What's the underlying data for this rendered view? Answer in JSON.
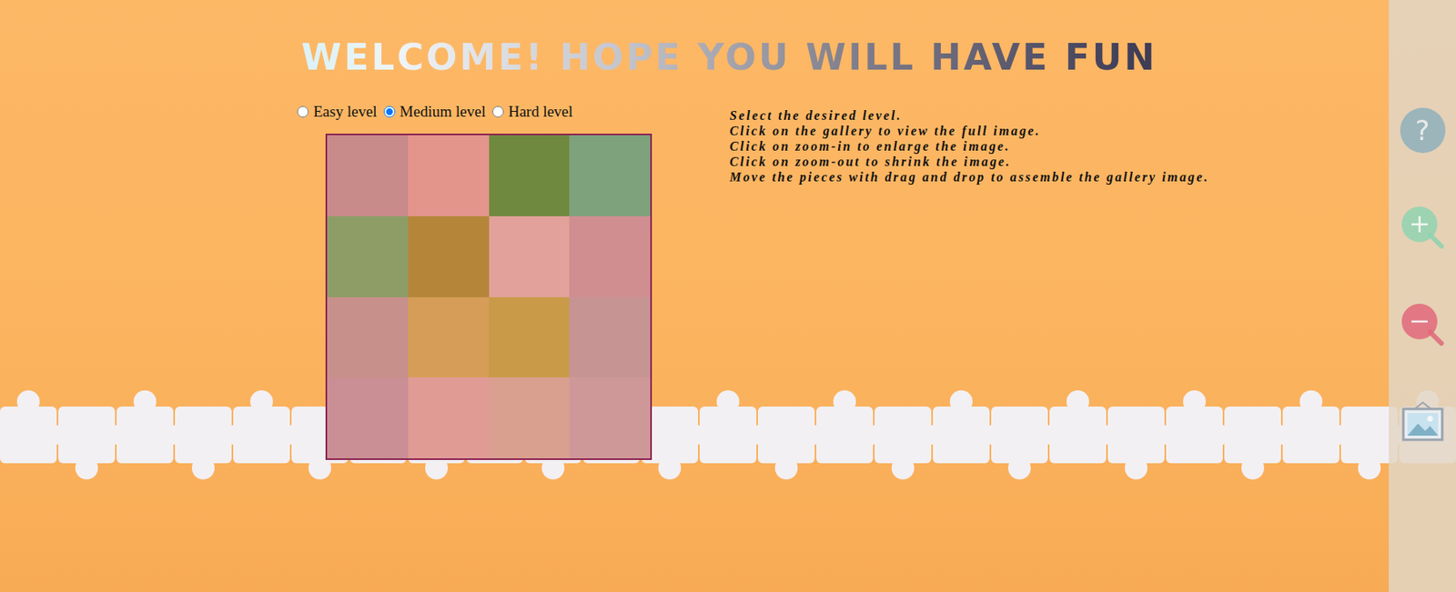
{
  "title": "WELCOME! HOPE YOU WILL HAVE FUN",
  "levels": [
    {
      "label": "Easy level",
      "selected": false
    },
    {
      "label": "Medium level",
      "selected": true
    },
    {
      "label": "Hard level",
      "selected": false
    }
  ],
  "instructions": [
    "Select the desired level.",
    "Click on the gallery to view the full image.",
    "Click on zoom-in to enlarge the image.",
    "Click on zoom-out to shrink the image.",
    "Move the pieces with drag and drop to assemble the gallery image."
  ],
  "board": {
    "columns": 4,
    "pieces": [
      {
        "color": "#c98a8a"
      },
      {
        "color": "#e3958c"
      },
      {
        "color": "#6f8a3e"
      },
      {
        "color": "#7da27c"
      },
      {
        "color": "#8e9d66"
      },
      {
        "color": "#b5863a"
      },
      {
        "color": "#e2a19a"
      },
      {
        "color": "#d08e90"
      },
      {
        "color": "#c7908a"
      },
      {
        "color": "#d69d58"
      },
      {
        "color": "#c99a48"
      },
      {
        "color": "#c79494"
      },
      {
        "color": "#c98f94"
      },
      {
        "color": "#e19b95"
      },
      {
        "color": "#d9a090"
      },
      {
        "color": "#cf9898"
      }
    ]
  },
  "toolbar": [
    {
      "kind": "help",
      "label": "?",
      "color": "#8fb1bd"
    },
    {
      "kind": "zoom-in",
      "color": "#8fd3b0"
    },
    {
      "kind": "zoom-out",
      "color": "#e0687a"
    },
    {
      "kind": "gallery",
      "color": "#9aa3ad"
    }
  ]
}
